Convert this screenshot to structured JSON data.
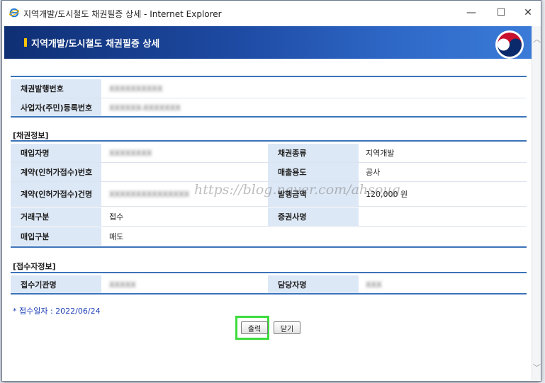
{
  "window": {
    "title": "지역개발/도시철도 채권필증 상세 - Internet Explorer",
    "min_glyph": "—",
    "max_glyph": "☐",
    "close_glyph": "✕"
  },
  "header": {
    "title": "지역개발/도시철도 채권필증 상세"
  },
  "bond_top": {
    "issue_no_label": "채권발행번호",
    "issue_no_value": "XXXXXXXXXX",
    "biz_reg_label": "사업자(주민)등록번호",
    "biz_reg_value": "XXXXXX-XXXXXXX"
  },
  "bond_info": {
    "section_title": "[채권정보]",
    "buyer_label": "매입자명",
    "buyer_value": "XXXXXXXX",
    "bond_type_label": "채권종류",
    "bond_type_value": "지역개발",
    "contract_no_label": "계약(인허가접수)번호",
    "contract_no_value": "",
    "sale_use_label": "매출용도",
    "sale_use_value": "공사",
    "contract_name_label": "계약(인허가접수)건명",
    "contract_name_value": "XXXXXXXXXXXXXXX",
    "amount_label": "발행금액",
    "amount_value": "120,000 원",
    "trade_type_label": "거래구분",
    "trade_type_value": "접수",
    "securities_label": "증권사명",
    "securities_value": "",
    "purchase_type_label": "매입구분",
    "purchase_type_value": "매도"
  },
  "receiver_info": {
    "section_title": "[접수자정보]",
    "org_label": "접수기관명",
    "org_value": "XXXXX",
    "manager_label": "담당자명",
    "manager_value": "XXX"
  },
  "note": "* 접수일자 : 2022/06/24",
  "buttons": {
    "print_label": "출력",
    "close_label": "닫기"
  },
  "watermark": "https://blog.naver.com/ahsoug",
  "colors": {
    "header_dark": "#0f2f74",
    "header_light": "#3b7bd8",
    "label_bg": "#dde8f6",
    "rule": "#3b73b9",
    "highlight": "#3ddc3d"
  }
}
